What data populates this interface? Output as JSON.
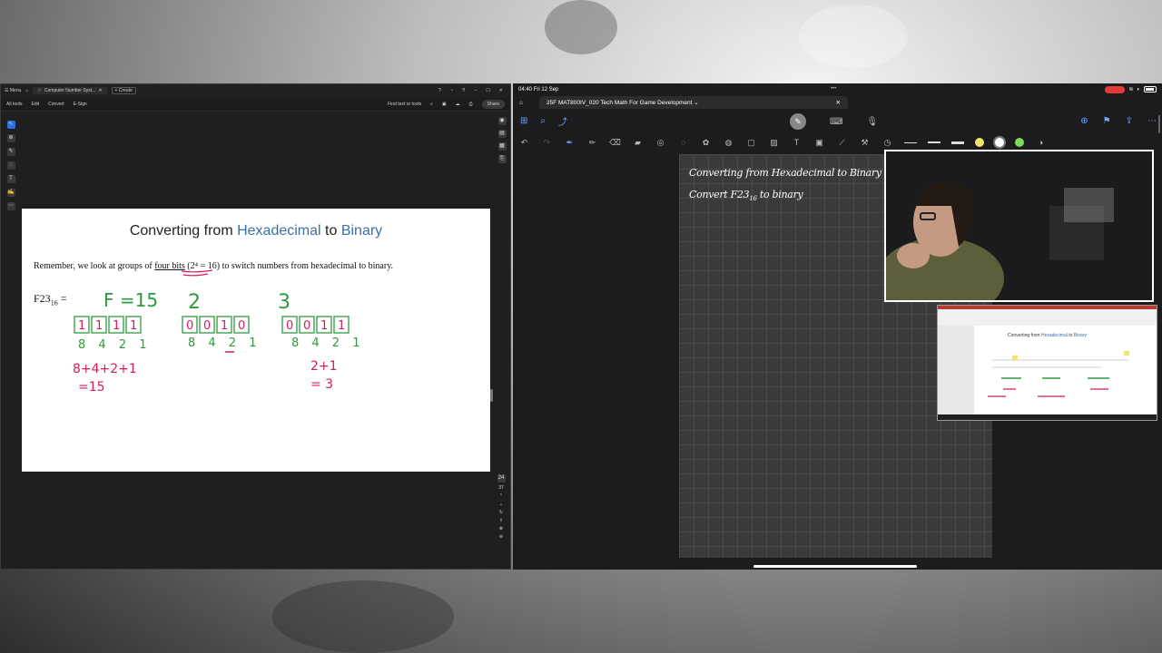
{
  "pdf": {
    "titlebar": {
      "menu": "Menu",
      "tab_title": "Computer Number Syst...",
      "create": "Create"
    },
    "toolbar": {
      "all_tools": "All tools",
      "edit": "Edit",
      "convert": "Convert",
      "esign": "E-Sign",
      "find": "Find text or tools",
      "share": "Share"
    },
    "page_numbers": {
      "current": "24",
      "total": "37"
    },
    "slide": {
      "title_pre": "Converting from ",
      "title_hex": "Hexadecimal",
      "title_mid": " to ",
      "title_bin": "Binary",
      "text_pre": "Remember, we look at groups of ",
      "text_under": "four bits",
      "text_post": " (2⁴ = 16) to switch numbers from hexadecimal to binary.",
      "formula": "F23",
      "formula_sub": "16",
      "formula_eq": " ="
    },
    "ink": {
      "color": "#d81b60",
      "green": "#2e9a3e",
      "labels": [
        "F =15",
        "2",
        "3"
      ],
      "weights": [
        "8 4 2 1",
        "8 4 2 1",
        "8 4 2 1"
      ],
      "groups": [
        [
          "1",
          "1",
          "1",
          "1"
        ],
        [
          "0",
          "0",
          "1",
          "0"
        ],
        [
          "0",
          "0",
          "1",
          "1"
        ]
      ],
      "sum1": "8+4+2+1",
      "res1": "=15",
      "sum3": "2+1",
      "res3": "= 3"
    }
  },
  "ipad": {
    "status": {
      "time": "04:40",
      "date": "Fri 12 Sep",
      "dots": "•••"
    },
    "doc_title": "25F MAT800IV_020 Tech Math For Game Development",
    "notes": {
      "line1": "Converting from Hexadecimal to Binary",
      "line2_pre": "Convert F23",
      "line2_sub": "16",
      "line2_post": " to binary"
    },
    "thumb": {
      "title_pre": "Converting from ",
      "title_hex": "Hexadecimal",
      "title_mid": " to ",
      "title_bin": "Binary"
    }
  }
}
